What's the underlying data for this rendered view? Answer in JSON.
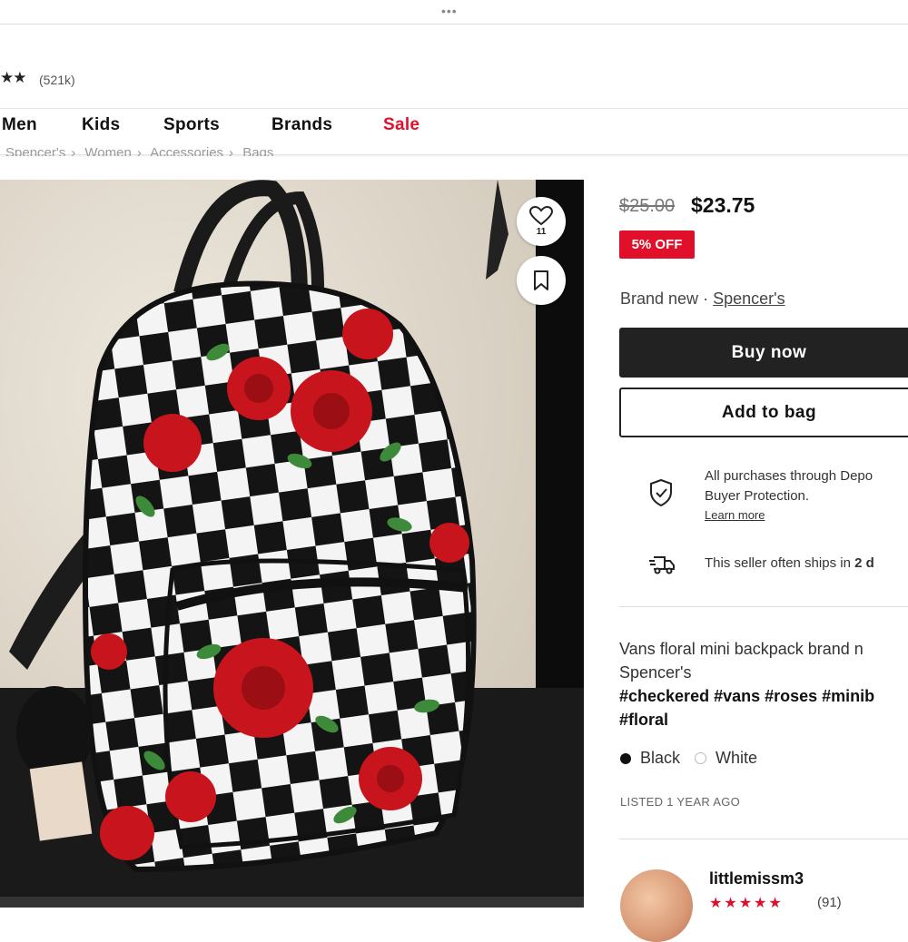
{
  "header": {
    "menu_dots": "•••",
    "rating_stars": "★★",
    "rating_count": "(521k)"
  },
  "nav": {
    "items": [
      "Men",
      "Kids",
      "Sports",
      "Brands",
      "Sale"
    ]
  },
  "breadcrumb": [
    "Spencer's",
    "Women",
    "Accessories",
    "Bags"
  ],
  "photo": {
    "like_count": "11"
  },
  "product": {
    "original_price": "$25.00",
    "price": "$23.75",
    "discount_badge": "5% OFF",
    "condition": "Brand new",
    "separator": "·",
    "brand": "Spencer's"
  },
  "actions": {
    "buy_now": "Buy now",
    "add_to_bag": "Add to bag"
  },
  "protection": {
    "line1": "All purchases through Depo",
    "line2": "Buyer Protection.",
    "learn_more": "Learn more"
  },
  "shipping": {
    "text": "This seller often ships in ",
    "bold": "2 d"
  },
  "description": {
    "line1": "Vans floral mini backpack brand n",
    "line2": "Spencer's",
    "tags_line1": "#checkered #vans #roses #minib",
    "tags_line2": "#floral"
  },
  "colors": {
    "options": [
      "Black",
      "White"
    ],
    "colors_hex": [
      "#111111",
      "#ffffff"
    ]
  },
  "listed": "LISTED 1 YEAR AGO",
  "seller": {
    "username": "littlemissm3",
    "stars": "★★★★★",
    "review_count": "(91)"
  },
  "accent_colors": {
    "sale_red": "#e0102b",
    "dark": "#222222"
  }
}
